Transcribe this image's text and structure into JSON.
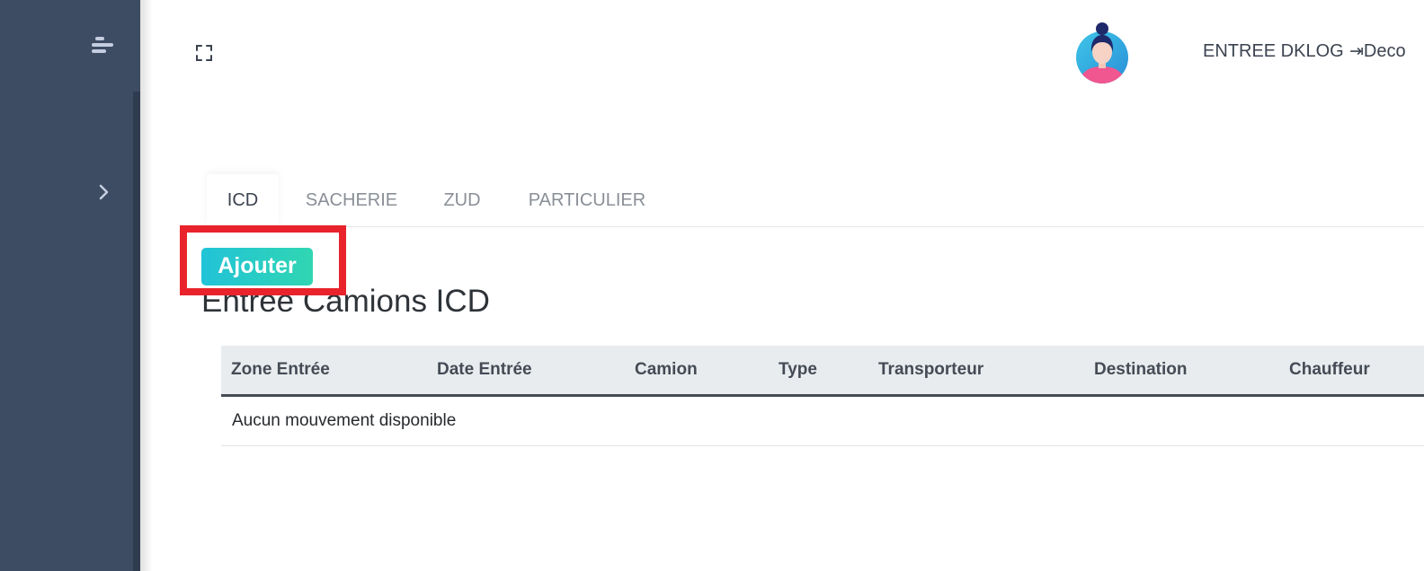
{
  "sidebar": {
    "menu_icon": "menu-icon",
    "expand_icon": "chevron-right-icon"
  },
  "header": {
    "fullscreen_icon": "fullscreen-icon",
    "avatar_icon": "user-avatar-icon",
    "user_name": "ENTREE DKLOG",
    "logout_icon": "logout-icon",
    "logout_label": "Deco"
  },
  "tabs": [
    {
      "label": "ICD",
      "active": true
    },
    {
      "label": "SACHERIE",
      "active": false
    },
    {
      "label": "ZUD",
      "active": false
    },
    {
      "label": "PARTICULIER",
      "active": false
    }
  ],
  "actions": {
    "add_label": "Ajouter"
  },
  "section": {
    "title": "Entrée Camions ICD"
  },
  "table": {
    "columns": [
      "Zone Entrée",
      "Date Entrée",
      "Camion",
      "Type",
      "Transporteur",
      "Destination",
      "Chauffeur"
    ],
    "empty_message": "Aucun mouvement disponible"
  },
  "colors": {
    "sidebar_bg": "#3d4b63",
    "accent_from": "#21c3d7",
    "accent_to": "#30d6b2",
    "highlight": "#e8232b"
  }
}
